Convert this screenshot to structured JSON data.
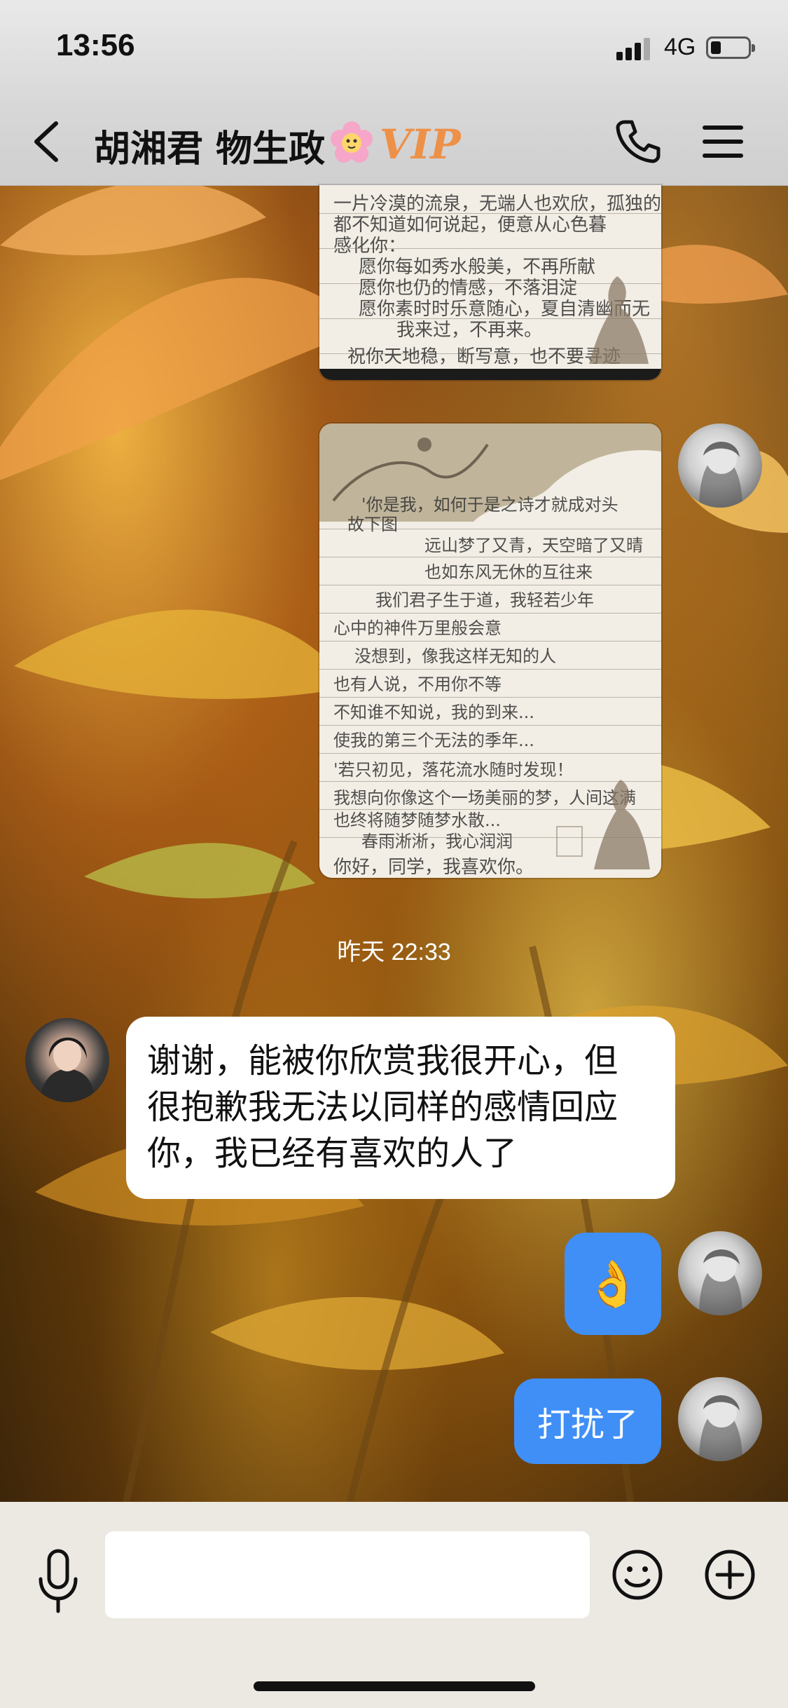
{
  "status_bar": {
    "time": "13:56",
    "network": "4G",
    "battery_level": 0.2
  },
  "nav": {
    "title": "胡湘君 物生政",
    "badge_text": "VIP",
    "icons": {
      "back": "chevron-left-icon",
      "call": "phone-icon",
      "menu": "hamburger-menu-icon"
    }
  },
  "messages": [
    {
      "type": "image",
      "direction": "outgoing",
      "description": "handwritten-letter-photo-top-cropped",
      "text_lines": [
        "一片冷漠的流泉，无端人也欢欣，孤独的人",
        "都不知道如何说起，便意从心色暮",
        "感化你：",
        "愿你每如秀水般美，不再所献",
        "愿你也仍的情感，不落泪淀",
        "愿你素时时乐意随心，夏自清幽而无",
        "我来过，不再来。",
        "祝你天地稳，断写意，也不要寻迹"
      ]
    },
    {
      "type": "image",
      "direction": "outgoing",
      "description": "handwritten-letter-photo",
      "text_lines": [
        "'你是我，如何于是之诗才就成对头",
        "故下图",
        "远山梦了又青，天空暗了又晴",
        "也如东风无休的互往来",
        "我们君子生于道，我轻若少年",
        "心中的神件万里般会意",
        "没想到，像我这样无知的人",
        "也有人说，不用你不等",
        "不知谁不知说，我的到来...",
        "使我的第三个无法的季年...",
        "'若只初见，落花流水随时发现！",
        "我想向你像这个一场美丽的梦，人间这满",
        "也终将随梦随梦水散...",
        "春雨淅淅，我心润润",
        "你好，同学，我喜欢你。"
      ]
    },
    {
      "type": "timestamp",
      "text": "昨天 22:33"
    },
    {
      "type": "text",
      "direction": "incoming",
      "text_lines": [
        "谢谢，能被你欣赏我很开心，但",
        "很抱歉我无法以同样的感情回应",
        "你，我已经有喜欢的人了"
      ]
    },
    {
      "type": "emoji",
      "direction": "outgoing",
      "text": "👌"
    },
    {
      "type": "text",
      "direction": "outgoing",
      "text": "打扰了"
    }
  ],
  "input_bar": {
    "placeholder": "",
    "value": "",
    "icons": {
      "voice": "microphone-icon",
      "emoji": "smiley-face-icon",
      "more": "plus-circle-icon"
    }
  },
  "colors": {
    "bubble_out": "#3f8ff7",
    "bubble_in": "#ffffff",
    "nav_bg": "#d3d3d4",
    "input_bar_bg": "#ece9e3"
  }
}
